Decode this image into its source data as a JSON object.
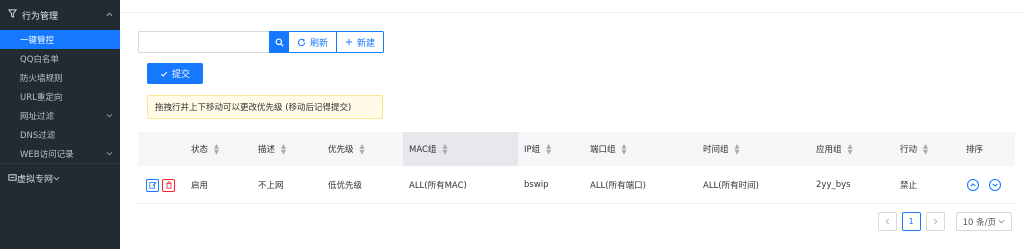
{
  "sidebar": {
    "group_behavior": {
      "label": "行为管理",
      "icon": "filter-icon"
    },
    "items": [
      {
        "label": "一键管控",
        "active": true,
        "expandable": false
      },
      {
        "label": "QQ白名单",
        "active": false,
        "expandable": false
      },
      {
        "label": "防火墙规则",
        "active": false,
        "expandable": false
      },
      {
        "label": "URL重定向",
        "active": false,
        "expandable": false
      },
      {
        "label": "网址过滤",
        "active": false,
        "expandable": true
      },
      {
        "label": "DNS过滤",
        "active": false,
        "expandable": false
      },
      {
        "label": "WEB访问记录",
        "active": false,
        "expandable": true
      }
    ],
    "group_vpn": {
      "label": "虚拟专网",
      "icon": "vpn-icon"
    }
  },
  "toolbar": {
    "search_placeholder": "",
    "refresh_label": "刷新",
    "new_label": "新建"
  },
  "submit_label": "提交",
  "notice_text": "拖拽行并上下移动可以更改优先级 (移动后记得提交)",
  "table": {
    "headers": {
      "status": "状态",
      "desc": "描述",
      "priority": "优先级",
      "mac": "MAC组",
      "ip": "IP组",
      "port": "端口组",
      "time": "时间组",
      "app": "应用组",
      "action": "行动",
      "order": "排序"
    },
    "rows": [
      {
        "status": "启用",
        "desc": "不上网",
        "priority": "低优先级",
        "mac": "ALL(所有MAC)",
        "ip": "bswip",
        "port": "ALL(所有端口)",
        "time": "ALL(所有时间)",
        "app": "2yy_bys",
        "action": "禁止"
      }
    ]
  },
  "pagination": {
    "current_page": "1",
    "page_size": "10 条/页"
  },
  "colors": {
    "primary": "#1677ff",
    "danger": "#f5222d",
    "sidebar_bg": "#222a33",
    "notice_bg": "#fffbe6"
  }
}
